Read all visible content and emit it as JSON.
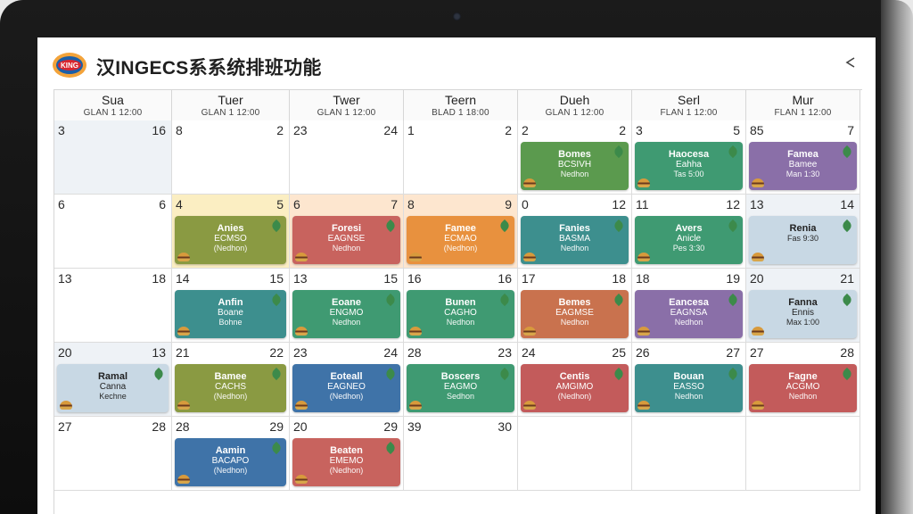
{
  "app": {
    "title": "汉INGECS系系统排班功能",
    "logo_text": "KING"
  },
  "colors": {
    "green": "#5b9a4e",
    "olive": "#8a9a42",
    "red": "#c8635e",
    "orange": "#e8913e",
    "teal": "#3d8f8e",
    "purple": "#8a6fa8",
    "blue": "#3f73a8",
    "tealgreen": "#3f9a72",
    "brown": "#c9724e",
    "light": "#c8d8e4",
    "pinkred": "#c35b5b"
  },
  "columns": [
    {
      "name": "Sua",
      "sub": "GLAN 1 12:00"
    },
    {
      "name": "Tuer",
      "sub": "GLAN 1 12:00"
    },
    {
      "name": "Twer",
      "sub": "GLAN 1 12:00"
    },
    {
      "name": "Teern",
      "sub": "BLAD 1 18:00"
    },
    {
      "name": "Dueh",
      "sub": "GLAN 1 12:00"
    },
    {
      "name": "Serl",
      "sub": "FLAN 1 12:00"
    },
    {
      "name": "Mur",
      "sub": "FLAN 1 12:00"
    }
  ],
  "weeks": [
    [
      {
        "l": "3",
        "r": "16",
        "tint": true
      },
      {
        "l": "8",
        "r": "2"
      },
      {
        "l": "23",
        "r": "24"
      },
      {
        "l": "1",
        "r": "2"
      },
      {
        "l": "2",
        "r": "2",
        "shift": {
          "color": "green",
          "l1": "Bomes",
          "l2": "BCSIVH",
          "l3": "Nedhon"
        }
      },
      {
        "l": "3",
        "r": "5",
        "shift": {
          "color": "tealgreen",
          "l1": "Haocesa",
          "l2": "Eahha",
          "l3": "Tas 5:00"
        }
      },
      {
        "l": "85",
        "r": "7",
        "shift": {
          "color": "purple",
          "l1": "Famea",
          "l2": "Bamee",
          "l3": "Man 1:30"
        }
      }
    ],
    [
      {
        "l": "6",
        "r": "6"
      },
      {
        "l": "4",
        "r": "5",
        "bg": "yellow",
        "shift": {
          "color": "olive",
          "l1": "Anies",
          "l2": "ECMSO",
          "l3": "(Nedhon)"
        }
      },
      {
        "l": "6",
        "r": "7",
        "bg": "peach",
        "shift": {
          "color": "red",
          "l1": "Foresi",
          "l2": "EAGNSE",
          "l3": "Nedhon"
        }
      },
      {
        "l": "8",
        "r": "9",
        "bg": "peach",
        "shift": {
          "color": "orange",
          "l1": "Famee",
          "l2": "ECMAO",
          "l3": "(Nedhon)"
        }
      },
      {
        "l": "0",
        "r": "12",
        "shift": {
          "color": "teal",
          "l1": "Fanies",
          "l2": "BASMA",
          "l3": "Nedhon"
        }
      },
      {
        "l": "11",
        "r": "12",
        "shift": {
          "color": "tealgreen",
          "l1": "Avers",
          "l2": "Anicle",
          "l3": "Pes 3:30"
        }
      },
      {
        "l": "13",
        "r": "14",
        "tint": true,
        "shift": {
          "color": "light",
          "dark": true,
          "l1": "Renia",
          "l2": "",
          "l3": "Fas 9:30"
        }
      }
    ],
    [
      {
        "l": "13",
        "r": "18"
      },
      {
        "l": "14",
        "r": "15",
        "shift": {
          "color": "teal",
          "l1": "Anfin",
          "l2": "Boane",
          "l3": "Bohne"
        }
      },
      {
        "l": "13",
        "r": "15",
        "shift": {
          "color": "tealgreen",
          "l1": "Eoane",
          "l2": "ENGMO",
          "l3": "Nedhon"
        }
      },
      {
        "l": "16",
        "r": "16",
        "shift": {
          "color": "tealgreen",
          "l1": "Bunen",
          "l2": "CAGHO",
          "l3": "Nedhon"
        }
      },
      {
        "l": "17",
        "r": "18",
        "shift": {
          "color": "brown",
          "l1": "Bemes",
          "l2": "EAGMSE",
          "l3": "Nedhon"
        }
      },
      {
        "l": "18",
        "r": "19",
        "shift": {
          "color": "purple",
          "l1": "Eancesa",
          "l2": "EAGNSA",
          "l3": "Nedhon"
        }
      },
      {
        "l": "20",
        "r": "21",
        "tint": true,
        "shift": {
          "color": "light",
          "dark": true,
          "l1": "Fanna",
          "l2": "Ennis",
          "l3": "Max 1:00"
        }
      }
    ],
    [
      {
        "l": "20",
        "r": "13",
        "tint": true,
        "shift": {
          "color": "light",
          "dark": true,
          "l1": "Ramal",
          "l2": "Canna",
          "l3": "Kechne"
        }
      },
      {
        "l": "21",
        "r": "22",
        "shift": {
          "color": "olive",
          "l1": "Bamee",
          "l2": "CACHS",
          "l3": "(Nedhon)"
        }
      },
      {
        "l": "23",
        "r": "24",
        "shift": {
          "color": "blue",
          "l1": "Eoteall",
          "l2": "EAGNEO",
          "l3": "(Nedhon)"
        }
      },
      {
        "l": "28",
        "r": "23",
        "shift": {
          "color": "tealgreen",
          "l1": "Boscers",
          "l2": "EAGMO",
          "l3": "Sedhon"
        }
      },
      {
        "l": "24",
        "r": "25",
        "shift": {
          "color": "pinkred",
          "l1": "Centis",
          "l2": "AMGIMO",
          "l3": "(Nedhon)"
        }
      },
      {
        "l": "26",
        "r": "27",
        "shift": {
          "color": "teal",
          "l1": "Bouan",
          "l2": "EASSO",
          "l3": "Nedhon"
        }
      },
      {
        "l": "27",
        "r": "28",
        "shift": {
          "color": "pinkred",
          "l1": "Fagne",
          "l2": "ACGMO",
          "l3": "Nedhon"
        }
      }
    ],
    [
      {
        "l": "27",
        "r": "28"
      },
      {
        "l": "28",
        "r": "29",
        "shift": {
          "color": "blue",
          "l1": "Aamin",
          "l2": "BACAPO",
          "l3": "(Nedhon)"
        }
      },
      {
        "l": "20",
        "r": "29",
        "shift": {
          "color": "red",
          "l1": "Beaten",
          "l2": "EMEMO",
          "l3": "(Nedhon)"
        }
      },
      {
        "l": "39",
        "r": "30"
      },
      {
        "l": "",
        "r": ""
      },
      {
        "l": "",
        "r": ""
      },
      {
        "l": "",
        "r": ""
      }
    ]
  ]
}
